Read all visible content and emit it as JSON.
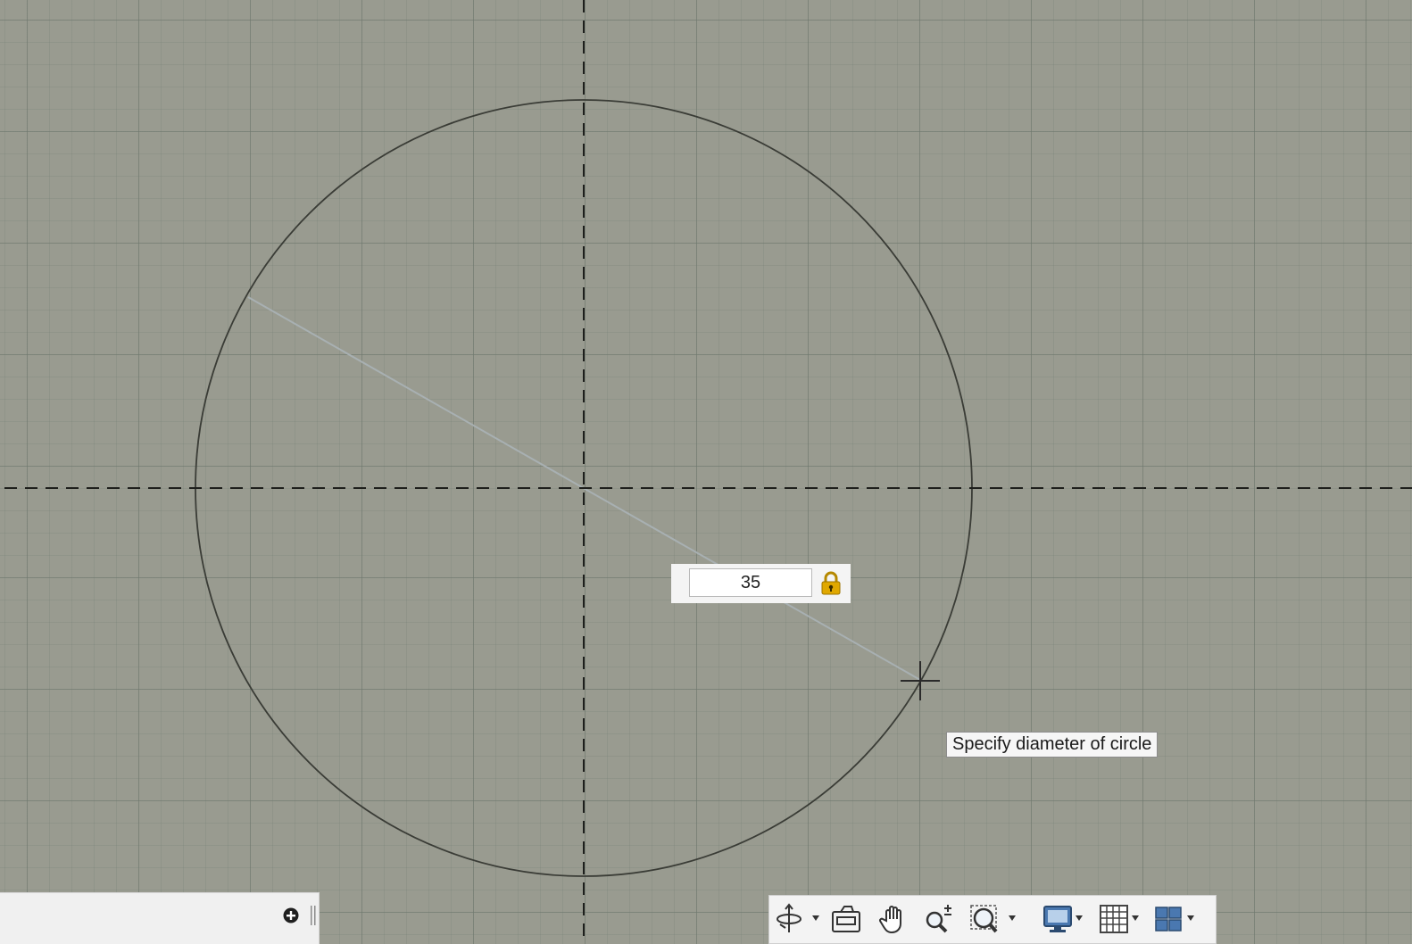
{
  "dimension_input": {
    "value": "35"
  },
  "tooltip": {
    "text": "Specify diameter of circle"
  },
  "icons": {
    "lock": "lock-icon",
    "add": "plus-circle-icon",
    "grip": "grip-handle-icon",
    "orbit": "orbit-icon",
    "steering_wheel": "steering-wheel-icon",
    "pan": "pan-hand-icon",
    "zoom_realtime": "zoom-realtime-icon",
    "zoom_window": "zoom-window-icon",
    "display_settings": "display-settings-icon",
    "grid_settings": "grid-settings-icon",
    "viewports": "viewports-icon"
  },
  "colors": {
    "canvas_background": "#999b90",
    "sketch_line": "#3a3c36",
    "lock_accent": "#e0a800"
  }
}
